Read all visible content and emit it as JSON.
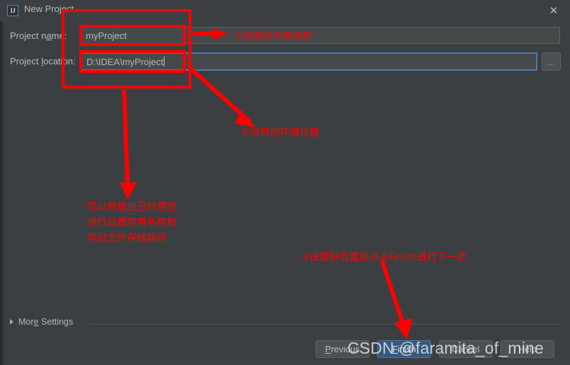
{
  "window": {
    "title": "New Project",
    "icon": "intellij-idea-icon",
    "icon_text": "IJ",
    "close_label": "✕"
  },
  "form": {
    "name_label_pre": "Project n",
    "name_label_mnemonic": "a",
    "name_label_post": "me:",
    "name_label_full": "Project name:",
    "name_value": "myProject",
    "location_label_pre": "Project ",
    "location_label_mnemonic": "l",
    "location_label_post": "ocation:",
    "location_label_full": "Project location:",
    "location_value": "D:\\IDEA\\myProject",
    "browse_label": "...",
    "more_settings_pre": "Mor",
    "more_settings_mnemonic": "e",
    "more_settings_post": " Settings",
    "more_settings_full": "More Settings"
  },
  "buttons": {
    "previous_pre": "",
    "previous_mnemonic": "P",
    "previous_post": "revious",
    "previous_full": "Previous",
    "finish_mnemonic": "F",
    "finish_post": "inish",
    "finish_full": "Finish",
    "cancel_full": "Cancel",
    "help_full": "Help"
  },
  "annotations": {
    "a1": "①创建的项目名称",
    "a2": "②项目的存储位置",
    "a3_line1": "可以根据自己的意愿",
    "a3_line2": "进行设置项目名称和",
    "a3_line3": "项目文件存储路径",
    "a4": "③设置好后直接点击Finish进行下一步",
    "color": "#ff0000"
  },
  "watermark": {
    "text": "CSDN @faramita_of_mine"
  }
}
